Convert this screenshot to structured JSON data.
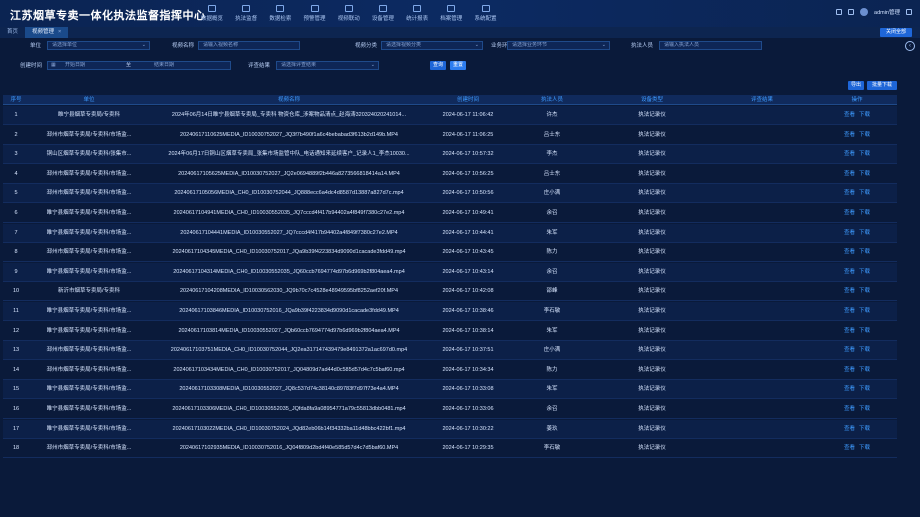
{
  "app": {
    "title": "江苏烟草专卖一体化执法监督指挥中心"
  },
  "nav": [
    {
      "label": "数据概览"
    },
    {
      "label": "执法监督"
    },
    {
      "label": "数据检索"
    },
    {
      "label": "预警管理"
    },
    {
      "label": "视频联动"
    },
    {
      "label": "设备管理"
    },
    {
      "label": "统计报表"
    },
    {
      "label": "档案管理"
    },
    {
      "label": "系统配置"
    }
  ],
  "header_right": {
    "user": "admin管理"
  },
  "tabs": [
    {
      "label": "首页"
    },
    {
      "label": "视频管理",
      "close": "×"
    }
  ],
  "tab_close_all": "关闭全部",
  "filters": {
    "unit_label": "单位",
    "unit_placeholder": "请选择单位",
    "name_label": "视频名称",
    "name_placeholder": "请输入视频名称",
    "category_label": "视频分类",
    "category_placeholder": "请选择视频分类",
    "stage_label": "业务环节",
    "stage_placeholder": "请选择业务环节",
    "officer_label": "执法人员",
    "officer_placeholder": "请输入执法人员",
    "time_label": "创建时间",
    "start_placeholder": "开始日期",
    "to": "至",
    "end_placeholder": "结束日期",
    "result_label": "评查结果",
    "result_placeholder": "请选择评查结果",
    "search_button": "查询",
    "reset_button": "重置"
  },
  "table_actions": {
    "export": "导出",
    "batch": "批量下载"
  },
  "columns": [
    "序号",
    "单位",
    "视频名称",
    "创建时间",
    "执法人员",
    "设备类型",
    "评查结果",
    "操作"
  ],
  "row_actions": {
    "view": "查看",
    "download": "下载"
  },
  "rows": [
    [
      "1",
      "睢宁县烟草专卖局/专卖科",
      "2024年06月14日睢宁县烟草专卖局_专卖科 物资仓库_涉案物品清点_赵海涛320324020241014...",
      "2024-06-17 11:06:42",
      "许杰",
      "执法记录仪"
    ],
    [
      "2",
      "邳州市烟草专卖局/专卖科/市场监...",
      "20240617110625MEDIA_ID10030752027_JQ3f7b490f1a6c4bebabad3f613b2d149b.MP4",
      "2024-06-17 11:06:25",
      "吕士东",
      "执法记录仪"
    ],
    [
      "3",
      "铜山区烟草专卖局/专卖科/张集市...",
      "2024年06月17日铜山区烟草专卖局_张集市场监管中队_电话通知来延续客户_记录人1_李杰10030...",
      "2024-06-17 10:57:32",
      "李杰",
      "执法记录仪"
    ],
    [
      "4",
      "邳州市烟草专卖局/专卖科/市场监...",
      "20240617105625MEDIA_ID10030752027_JQ2e0694889f2b446a8273566818414a14.MP4",
      "2024-06-17 10:56:25",
      "吕士东",
      "执法记录仪"
    ],
    [
      "5",
      "邳州市烟草专卖局/专卖科/市场监...",
      "20240617105056MEDIA_CH0_ID10030752044_JQ888ecc6a4dc4d8587d13887a827d7c.mp4",
      "2024-06-17 10:50:56",
      "庄小满",
      "执法记录仪"
    ],
    [
      "6",
      "睢宁县烟草专卖局/专卖科/市场监...",
      "20240617104941MEDIA_CH0_ID10030552035_JQ7cccd4f417b94402a4f849f7380c27e2.mp4",
      "2024-06-17 10:49:41",
      "余召",
      "执法记录仪"
    ],
    [
      "7",
      "睢宁县烟草专卖局/专卖科/市场监...",
      "20240617104441MEDIA_ID10030552027_JQ7cccd4f417b94402a4f849f7380c27e2.MP4",
      "2024-06-17 10:44:41",
      "朱军",
      "执法记录仪"
    ],
    [
      "8",
      "邳州市烟草专卖局/专卖科/市场监...",
      "20240617104345MEDIA_CH0_ID10030752017_JQa9b39f4223834d9090d1cacade3fdd49.mp4",
      "2024-06-17 10:43:45",
      "陈力",
      "执法记录仪"
    ],
    [
      "9",
      "睢宁县烟草专卖局/专卖科/市场监...",
      "20240617104314MEDIA_CH0_ID10030552035_JQ60ccb7694774d97b6d969b2f804aea4.mp4",
      "2024-06-17 10:43:14",
      "余召",
      "执法记录仪"
    ],
    [
      "10",
      "新沂市烟草专卖局/专卖科",
      "20240617104208MEDIA_ID10030562030_JQ9b70c7c4528e48949595bf8252aef20f.MP4",
      "2024-06-17 10:42:08",
      "邵峰",
      "执法记录仪"
    ],
    [
      "11",
      "睢宁县烟草专卖局/专卖科/市场监...",
      "20240617103846MEDIA_ID10030752016_JQa9b39f4223834d9090d1cacade3fdd49.MP4",
      "2024-06-17 10:38:46",
      "李石敏",
      "执法记录仪"
    ],
    [
      "12",
      "睢宁县烟草专卖局/专卖科/市场监...",
      "20240617103814MEDIA_ID10030552027_JQb60ccb7694774d97b6d969b2f804aea4.MP4",
      "2024-06-17 10:38:14",
      "朱军",
      "执法记录仪"
    ],
    [
      "13",
      "邳州市烟草专卖局/专卖科/市场监...",
      "20240617103751MEDIA_CH0_ID10030752044_JQ2ea317147439479e8491372a1ac697d0.mp4",
      "2024-06-17 10:37:51",
      "庄小满",
      "执法记录仪"
    ],
    [
      "14",
      "邳州市烟草专卖局/专卖科/市场监...",
      "20240617103434MEDIA_CH0_ID10030752017_JQ04809d7ad44d0c585d57d4c7c5baf60.mp4",
      "2024-06-17 10:34:34",
      "陈力",
      "执法记录仪"
    ],
    [
      "15",
      "睢宁县烟草专卖局/专卖科/市场监...",
      "20240617103308MEDIA_ID10030552027_JQ8c537d74c38140c89783f7d97f73e4a4.MP4",
      "2024-06-17 10:33:08",
      "朱军",
      "执法记录仪"
    ],
    [
      "16",
      "睢宁县烟草专卖局/专卖科/市场监...",
      "20240617103306MEDIA_CH0_ID10030552035_JQfda8fa9a08954771a79c55813dbb0481.mp4",
      "2024-06-17 10:33:06",
      "余召",
      "执法记录仪"
    ],
    [
      "17",
      "睢宁县烟草专卖局/专卖科/市场监...",
      "20240617103022MEDIA_CH0_ID10030752024_JQd82eb06b14f34332ba11d48bbc422bf1.mp4",
      "2024-06-17 10:30:22",
      "姜玖",
      "执法记录仪"
    ],
    [
      "18",
      "邳州市烟草专卖局/专卖科/市场监...",
      "20240617102935MEDIA_ID10030752016_JQ04f809d2bd4f40e585d57d4c7d5baf60.MP4",
      "2024-06-17 10:29:35",
      "李石敏",
      "执法记录仪"
    ]
  ]
}
